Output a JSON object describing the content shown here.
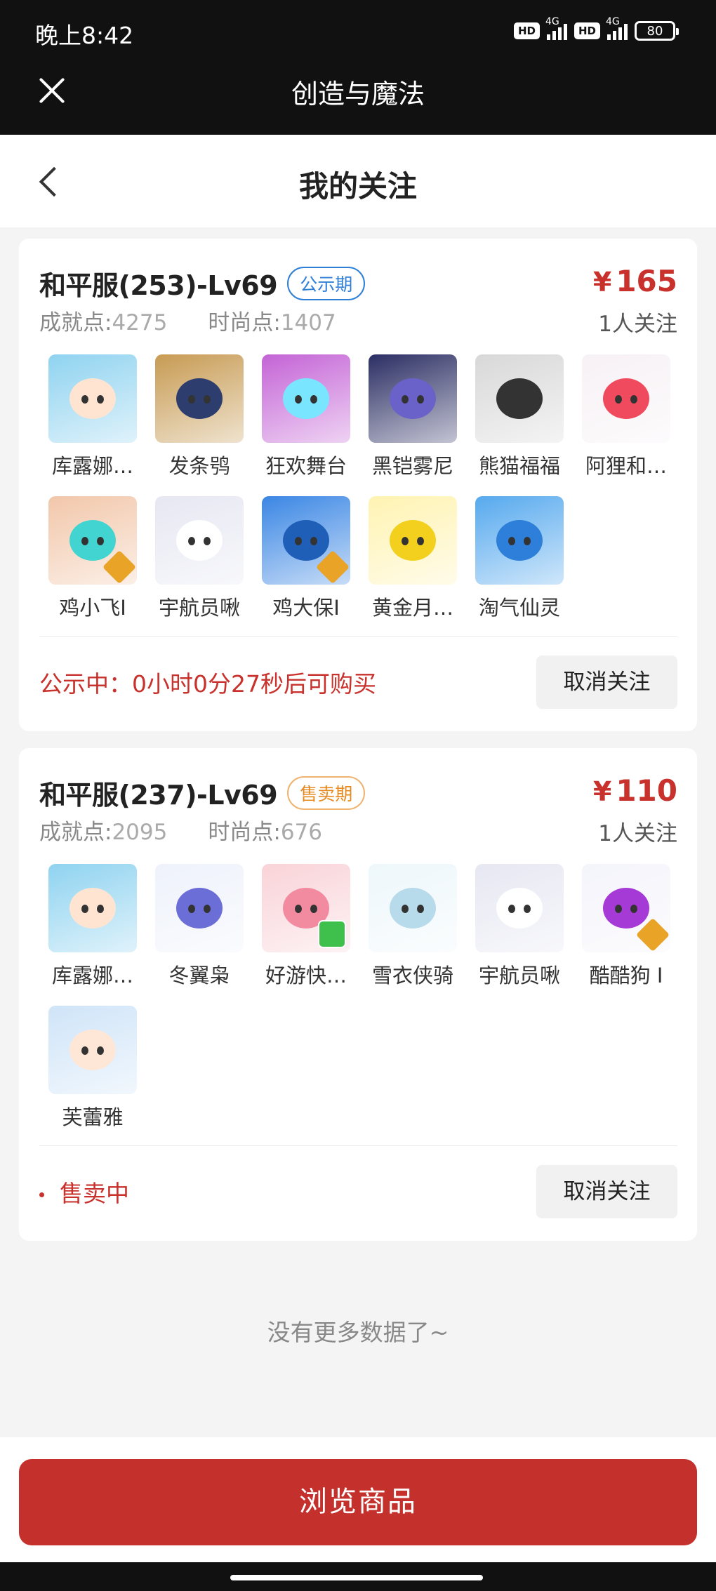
{
  "status_bar": {
    "time": "晚上8:42",
    "hd1": "HD",
    "net1": "4G",
    "hd2": "HD",
    "net2": "4G",
    "battery": "80"
  },
  "app": {
    "title": "创造与魔法"
  },
  "nav": {
    "title": "我的关注"
  },
  "cards": [
    {
      "server": "和平服(253)-Lv69",
      "tag": "公示期",
      "price_symbol": "¥",
      "price": "165",
      "achievement_label": "成就点:",
      "achievement_value": "4275",
      "fashion_label": "时尚点:",
      "fashion_value": "1407",
      "followers": "1人关注",
      "status": "公示中：0小时0分27秒后可购买",
      "unfollow_label": "取消关注",
      "items": [
        {
          "name": "库露娜…",
          "icon": "sheep-hat-girl",
          "color": "#8fd3f0",
          "face": "#ffe4d2",
          "badge": ""
        },
        {
          "name": "发条鸮",
          "icon": "clockwork-owl",
          "color": "#c79b53",
          "face": "#2d3d6e",
          "badge": ""
        },
        {
          "name": "狂欢舞台",
          "icon": "carnival-stage",
          "color": "#c463d6",
          "face": "#79e5ff",
          "badge": ""
        },
        {
          "name": "黑铠雾尼",
          "icon": "black-armor-dragon",
          "color": "#2b2e63",
          "face": "#6a62c9",
          "badge": ""
        },
        {
          "name": "熊猫福福",
          "icon": "panda",
          "color": "#d8d8d8",
          "face": "#333333",
          "badge": ""
        },
        {
          "name": "阿狸和…",
          "icon": "ali-fox",
          "color": "#f7f1f5",
          "face": "#f04a5e",
          "badge": ""
        },
        {
          "name": "鸡小飞I",
          "icon": "chick-flyer",
          "color": "#f2c7aa",
          "face": "#42d4d0",
          "badge": "gold"
        },
        {
          "name": "宇航员啾",
          "icon": "astronaut-cow",
          "color": "#e6e7f2",
          "face": "#ffffff",
          "badge": ""
        },
        {
          "name": "鸡大保I",
          "icon": "chick-boss",
          "color": "#3a86e4",
          "face": "#1f5fb8",
          "badge": "gold"
        },
        {
          "name": "黄金月…",
          "icon": "golden-moon-rabbit",
          "color": "#fff3b2",
          "face": "#f3cf1e",
          "badge": ""
        },
        {
          "name": "淘气仙灵",
          "icon": "naughty-spirit",
          "color": "#56a9ee",
          "face": "#2d7fd9",
          "badge": ""
        }
      ]
    },
    {
      "server": "和平服(237)-Lv69",
      "tag": "售卖期",
      "price_symbol": "¥",
      "price": "110",
      "achievement_label": "成就点:",
      "achievement_value": "2095",
      "fashion_label": "时尚点:",
      "fashion_value": "676",
      "followers": "1人关注",
      "status": "售卖中",
      "unfollow_label": "取消关注",
      "items": [
        {
          "name": "库露娜…",
          "icon": "sheep-hat-girl",
          "color": "#8fd3f0",
          "face": "#ffe4d2",
          "badge": ""
        },
        {
          "name": "冬翼枭",
          "icon": "winter-owl",
          "color": "#eef2fb",
          "face": "#6c6ed8",
          "badge": ""
        },
        {
          "name": "好游快…",
          "icon": "pink-pig",
          "color": "#f9d3d8",
          "face": "#f28aa0",
          "badge": "green"
        },
        {
          "name": "雪衣侠骑",
          "icon": "snow-horse",
          "color": "#eef7fb",
          "face": "#b7dbea",
          "badge": ""
        },
        {
          "name": "宇航员啾",
          "icon": "astronaut-cow",
          "color": "#e6e7f2",
          "face": "#ffffff",
          "badge": ""
        },
        {
          "name": "酷酷狗 I",
          "icon": "cool-dog",
          "color": "#f4f4fb",
          "face": "#a53ad6",
          "badge": "gold"
        },
        {
          "name": "芙蕾雅",
          "icon": "freya",
          "color": "#cfe4f8",
          "face": "#ffe7d8",
          "badge": ""
        }
      ]
    }
  ],
  "footer": {
    "no_more": "没有更多数据了~",
    "browse_label": "浏览商品"
  },
  "colors": {
    "accent": "#c4312c",
    "blue_tag": "#2f7fd6",
    "orange_tag": "#e58a1f"
  }
}
